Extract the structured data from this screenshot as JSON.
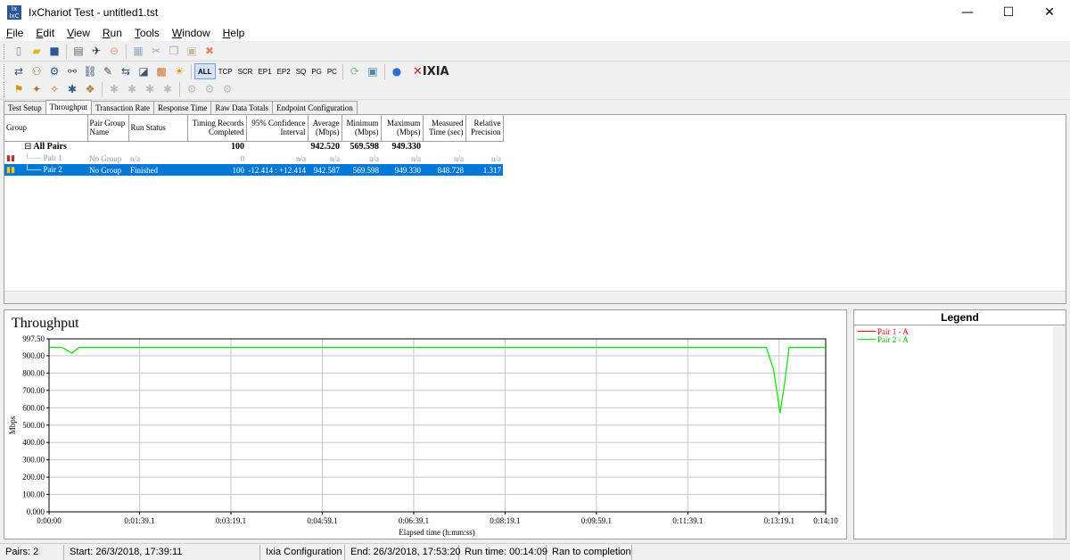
{
  "window": {
    "title": "IxChariot Test - untitled1.tst",
    "minimize": "—",
    "maximize": "☐",
    "close": "✕"
  },
  "menu": [
    "File",
    "Edit",
    "View",
    "Run",
    "Tools",
    "Window",
    "Help"
  ],
  "toolbar2": {
    "modes": [
      "ALL",
      "TCP",
      "SCR",
      "EP1",
      "EP2",
      "SQ",
      "PG",
      "PC"
    ],
    "active": "ALL",
    "logo_x": "✕",
    "logo_text": "IXIA"
  },
  "tabs": [
    "Test Setup",
    "Throughput",
    "Transaction Rate",
    "Response Time",
    "Raw Data Totals",
    "Endpoint Configuration"
  ],
  "active_tab": "Throughput",
  "grid": {
    "headers": [
      "Group",
      "Pair Group Name",
      "Run Status",
      "Timing Records Completed",
      "95% Confidence Interval",
      "Average (Mbps)",
      "Minimum (Mbps)",
      "Maximum (Mbps)",
      "Measured Time (sec)",
      "Relative Precision"
    ],
    "all_pairs": {
      "expander": "⊟",
      "label": "All Pairs",
      "records": "100",
      "average": "942.520",
      "minimum": "569.598",
      "maximum": "949.330"
    },
    "rows": [
      {
        "name": "Pair 1",
        "group": "No Group",
        "status": "n/a",
        "records": "0",
        "ci": "n/a",
        "average": "n/a",
        "minimum": "n/a",
        "maximum": "n/a",
        "time": "n/a",
        "precision": "n/a"
      },
      {
        "name": "Pair 2",
        "group": "No Group",
        "status": "Finished",
        "records": "100",
        "ci": "-12.414 : +12.414",
        "average": "942.587",
        "minimum": "569.598",
        "maximum": "949.330",
        "time": "848.728",
        "precision": "1.317"
      }
    ]
  },
  "chart_data": {
    "type": "line",
    "title": "Throughput",
    "xlabel": "Elapsed time (h:mm:ss)",
    "ylabel": "Mbps",
    "ylim": [
      0,
      997.5
    ],
    "xlim": [
      0,
      850
    ],
    "y_ticks": [
      "0.000",
      "100.00",
      "200.00",
      "300.00",
      "400.00",
      "500.00",
      "600.00",
      "700.00",
      "800.00",
      "900.00",
      "997.50"
    ],
    "y_tick_values": [
      0,
      100,
      200,
      300,
      400,
      500,
      600,
      700,
      800,
      900,
      997.5
    ],
    "x_ticks": [
      "0:00:00",
      "0:01:39.1",
      "0:03:19.1",
      "0:04:59.1",
      "0:06:39.1",
      "0:08:19.1",
      "0:09:59.1",
      "0:11:39.1",
      "0:13:19.1",
      "0:14:10"
    ],
    "x_tick_values": [
      0,
      99.1,
      199.1,
      299.1,
      399.1,
      499.1,
      599.1,
      699.1,
      799.1,
      850
    ],
    "grid": true,
    "series": [
      {
        "name": "Pair 1 - A",
        "color": "#ff0000",
        "x": [],
        "y": []
      },
      {
        "name": "Pair 2 - A",
        "color": "#00e000",
        "x": [
          0,
          15,
          25,
          33,
          100,
          200,
          300,
          400,
          500,
          600,
          700,
          785,
          793,
          800,
          805,
          810,
          850
        ],
        "y": [
          949,
          947,
          915,
          948,
          948,
          948,
          948,
          948,
          948,
          948,
          948,
          948,
          820,
          570,
          740,
          948,
          948
        ]
      }
    ]
  },
  "legend": {
    "title": "Legend"
  },
  "status": [
    "Pairs: 2",
    "Start: 26/3/2018, 17:39:11",
    "Ixia Configuration",
    "End: 26/3/2018, 17:53:20",
    "Run time: 00:14:09",
    "Ran to completion"
  ]
}
